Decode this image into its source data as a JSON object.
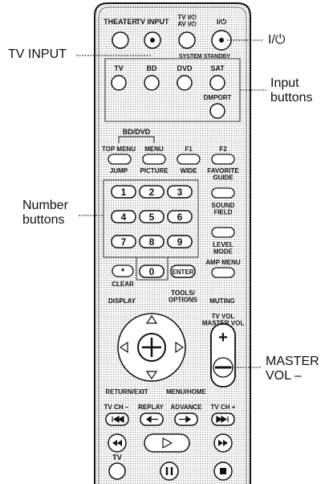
{
  "callouts": {
    "tv_input": "TV INPUT",
    "power": "I/⏻",
    "input_buttons": "Input\nbuttons",
    "number_buttons": "Number\nbuttons",
    "master_vol_minus": "MASTER\nVOL –"
  },
  "remote": {
    "top_row": {
      "theater": "THEATER",
      "tv_input": "TV INPUT",
      "tv_av": "TV I/⏻\nAV I/⏻",
      "power": "I/⏻"
    },
    "system_standby": "SYSTEM STANDBY",
    "inputs": [
      "TV",
      "BD",
      "DVD",
      "SAT"
    ],
    "dmport": "DMPORT",
    "bd_dvd": "BD/DVD",
    "menu_row": [
      "TOP MENU",
      "MENU",
      "F1",
      "F2"
    ],
    "menu_row_sub": [
      "JUMP",
      "PICTURE",
      "WIDE",
      "FAVORITE\nGUIDE"
    ],
    "numbers": [
      "1",
      "2",
      "3",
      "4",
      "5",
      "6",
      "7",
      "8",
      "9",
      "0"
    ],
    "star_label": "*",
    "clear": "CLEAR",
    "enter": "ENTER",
    "sound_field": "SOUND\nFIELD",
    "level_mode": "LEVEL\nMODE",
    "amp_menu": "AMP MENU",
    "display": "DISPLAY",
    "tools_options": "TOOLS/\nOPTIONS",
    "muting": "MUTING",
    "tv_vol_master_vol": "TV VOL\nMASTER VOL",
    "vol_plus": "+",
    "return_exit": "RETURN/EXIT",
    "menu_home": "MENU/HOME",
    "transport_labels": [
      "TV CH –",
      "REPLAY",
      "ADVANCE",
      "TV CH +"
    ],
    "tv_bottom": "TV"
  }
}
